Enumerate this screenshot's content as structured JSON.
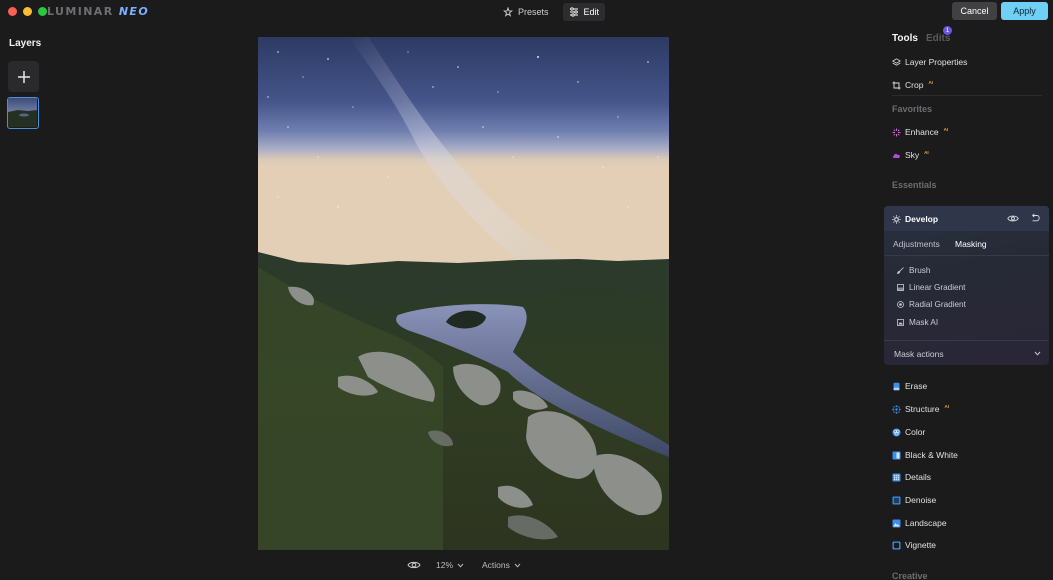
{
  "titlebar": {
    "logo_main": "LUMINAR",
    "logo_accent": "NEO",
    "modes": [
      {
        "label": "Presets",
        "active": false
      },
      {
        "label": "Edit",
        "active": true
      }
    ],
    "cancel_label": "Cancel",
    "apply_label": "Apply"
  },
  "layers": {
    "title": "Layers"
  },
  "canvas": {
    "zoom": "12%",
    "actions_label": "Actions"
  },
  "panel": {
    "tabs": [
      {
        "label": "Tools",
        "active": true
      },
      {
        "label": "Edits",
        "active": false,
        "badge": "1"
      }
    ],
    "top_tools": [
      {
        "label": "Layer Properties",
        "icon": "layers-icon",
        "ai": ""
      },
      {
        "label": "Crop",
        "icon": "crop-icon",
        "ai": "AI"
      }
    ],
    "favorites_title": "Favorites",
    "favorites": [
      {
        "label": "Enhance",
        "icon": "enhance-icon",
        "ai": "AI"
      },
      {
        "label": "Sky",
        "icon": "cloud-icon",
        "ai": "AI"
      }
    ],
    "essentials_title": "Essentials",
    "develop": {
      "title": "Develop",
      "tabs": [
        "Adjustments",
        "Masking"
      ],
      "active_tab": "Masking",
      "mask_tools": [
        {
          "label": "Brush",
          "icon": "brush-icon"
        },
        {
          "label": "Linear Gradient",
          "icon": "linear-gradient-icon"
        },
        {
          "label": "Radial Gradient",
          "icon": "radial-gradient-icon"
        },
        {
          "label": "Mask AI",
          "icon": "mask-ai-icon"
        }
      ],
      "mask_actions_label": "Mask actions"
    },
    "essentials": [
      {
        "label": "Erase",
        "icon": "erase-icon",
        "ai": ""
      },
      {
        "label": "Structure",
        "icon": "structure-icon",
        "ai": "AI"
      },
      {
        "label": "Color",
        "icon": "color-icon",
        "ai": ""
      },
      {
        "label": "Black & White",
        "icon": "black-white-icon",
        "ai": ""
      },
      {
        "label": "Details",
        "icon": "details-icon",
        "ai": ""
      },
      {
        "label": "Denoise",
        "icon": "denoise-icon",
        "ai": ""
      },
      {
        "label": "Landscape",
        "icon": "landscape-icon",
        "ai": ""
      },
      {
        "label": "Vignette",
        "icon": "vignette-icon",
        "ai": ""
      }
    ],
    "creative_title": "Creative"
  },
  "colors": {
    "accent": "#6fcff5",
    "ai_badge": "#f0a53c",
    "edits_badge": "#6c55e0",
    "layer_selected": "#4a8fd8"
  }
}
